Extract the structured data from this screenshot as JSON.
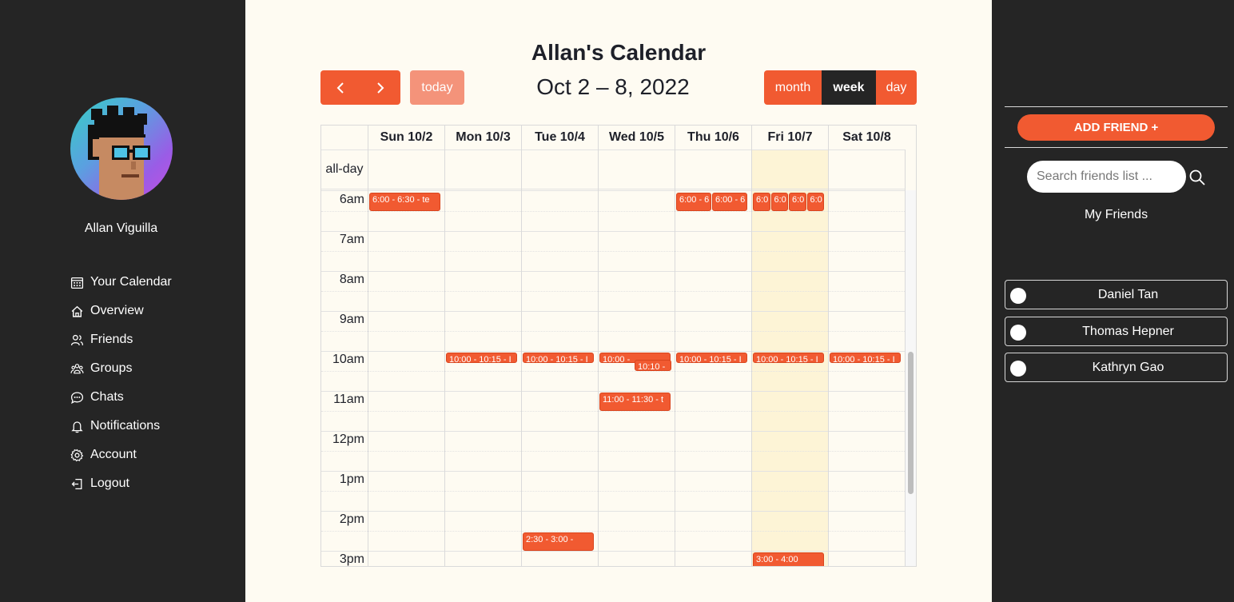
{
  "user": {
    "name": "Allan Viguilla"
  },
  "nav": [
    {
      "label": "Your Calendar",
      "icon": "calendar-icon"
    },
    {
      "label": "Overview",
      "icon": "home-icon"
    },
    {
      "label": "Friends",
      "icon": "users-icon"
    },
    {
      "label": "Groups",
      "icon": "group-icon"
    },
    {
      "label": "Chats",
      "icon": "chat-icon"
    },
    {
      "label": "Notifications",
      "icon": "bell-icon"
    },
    {
      "label": "Account",
      "icon": "gear-icon"
    },
    {
      "label": "Logout",
      "icon": "logout-icon"
    }
  ],
  "calendar": {
    "title": "Allan's Calendar",
    "today_label": "today",
    "range": "Oct 2 – 8, 2022",
    "views": {
      "month": "month",
      "week": "week",
      "day": "day",
      "active": "week"
    },
    "allday_label": "all-day",
    "days": [
      "Sun 10/2",
      "Mon 10/3",
      "Tue 10/4",
      "Wed 10/5",
      "Thu 10/6",
      "Fri 10/7",
      "Sat 10/8"
    ],
    "today_index": 5,
    "hours": [
      "6am",
      "7am",
      "8am",
      "9am",
      "10am",
      "11am",
      "12pm",
      "1pm",
      "2pm",
      "3pm"
    ],
    "events": [
      {
        "day": 0,
        "start": 6.0,
        "end": 6.5,
        "label": "6:00 - 6:30 - te",
        "lane": 0,
        "lanes": 1
      },
      {
        "day": 4,
        "start": 6.0,
        "end": 6.5,
        "label": "6:00 - 6",
        "lane": 0,
        "lanes": 2
      },
      {
        "day": 4,
        "start": 6.0,
        "end": 6.5,
        "label": "6:00 - 6",
        "lane": 1,
        "lanes": 2
      },
      {
        "day": 5,
        "start": 6.0,
        "end": 6.5,
        "label": "6:0",
        "lane": 0,
        "lanes": 4
      },
      {
        "day": 5,
        "start": 6.0,
        "end": 6.5,
        "label": "6:0",
        "lane": 1,
        "lanes": 4
      },
      {
        "day": 5,
        "start": 6.0,
        "end": 6.5,
        "label": "6:0",
        "lane": 2,
        "lanes": 4
      },
      {
        "day": 5,
        "start": 6.0,
        "end": 6.5,
        "label": "6:0",
        "lane": 3,
        "lanes": 4
      },
      {
        "day": 1,
        "start": 10.0,
        "end": 10.25,
        "label": "10:00 - 10:15 - I",
        "lane": 0,
        "lanes": 1
      },
      {
        "day": 2,
        "start": 10.0,
        "end": 10.25,
        "label": "10:00 - 10:15 - I",
        "lane": 0,
        "lanes": 1
      },
      {
        "day": 3,
        "start": 10.0,
        "end": 10.25,
        "label": "10:00 -",
        "lane": 0,
        "lanes": 1
      },
      {
        "day": 3,
        "start": 10.17,
        "end": 10.5,
        "label": "10:10 -",
        "lane": 1,
        "lanes": 2
      },
      {
        "day": 4,
        "start": 10.0,
        "end": 10.25,
        "label": "10:00 - 10:15 - I",
        "lane": 0,
        "lanes": 1
      },
      {
        "day": 5,
        "start": 10.0,
        "end": 10.25,
        "label": "10:00 - 10:15 - I",
        "lane": 0,
        "lanes": 1
      },
      {
        "day": 6,
        "start": 10.0,
        "end": 10.25,
        "label": "10:00 - 10:15 - I",
        "lane": 0,
        "lanes": 1
      },
      {
        "day": 3,
        "start": 11.0,
        "end": 11.5,
        "label": "11:00 - 11:30 - t",
        "lane": 0,
        "lanes": 1
      },
      {
        "day": 2,
        "start": 14.5,
        "end": 15.0,
        "label": "2:30 - 3:00 -",
        "lane": 0,
        "lanes": 1
      },
      {
        "day": 5,
        "start": 15.0,
        "end": 16.0,
        "label": "3:00 - 4:00",
        "lane": 0,
        "lanes": 1
      }
    ]
  },
  "friends_panel": {
    "add_friend_label": "ADD FRIEND +",
    "search_placeholder": "Search friends list ...",
    "heading": "My Friends",
    "friends": [
      "Daniel Tan",
      "Thomas Hepner",
      "Kathryn Gao"
    ]
  },
  "colors": {
    "accent": "#f15a31",
    "sidebar": "#252525",
    "main_bg": "#fefbf2",
    "today_highlight": "#fdf4d6"
  }
}
